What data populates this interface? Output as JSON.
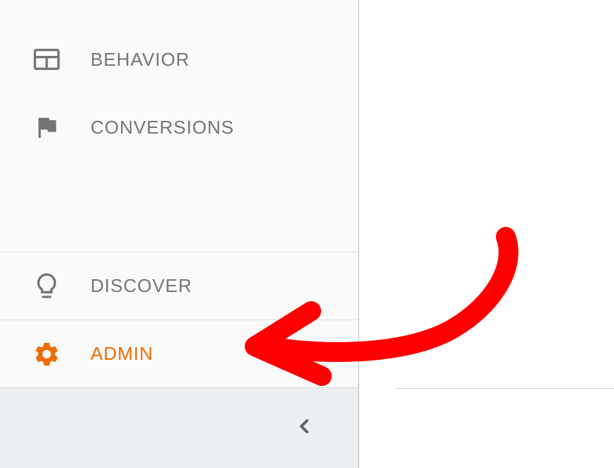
{
  "sidebar": {
    "items": [
      {
        "label": "BEHAVIOR"
      },
      {
        "label": "CONVERSIONS"
      },
      {
        "label": "DISCOVER"
      },
      {
        "label": "ADMIN"
      }
    ]
  },
  "colors": {
    "accent": "#ef6c00",
    "icon": "#757575",
    "annotation": "#ff0000"
  }
}
